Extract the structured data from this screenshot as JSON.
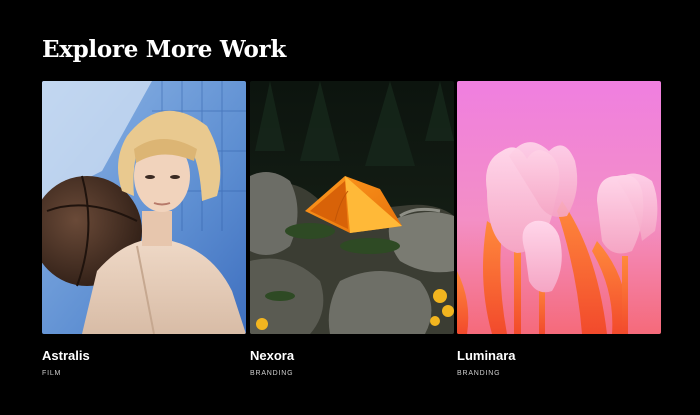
{
  "section": {
    "title": "Explore More Work"
  },
  "projects": [
    {
      "name": "Astralis",
      "category": "FILM"
    },
    {
      "name": "Nexora",
      "category": "BRANDING"
    },
    {
      "name": "Luminara",
      "category": "BRANDING"
    }
  ],
  "colors": {
    "background": "#000000",
    "text": "#ffffff",
    "muted": "#cfcfcf"
  }
}
